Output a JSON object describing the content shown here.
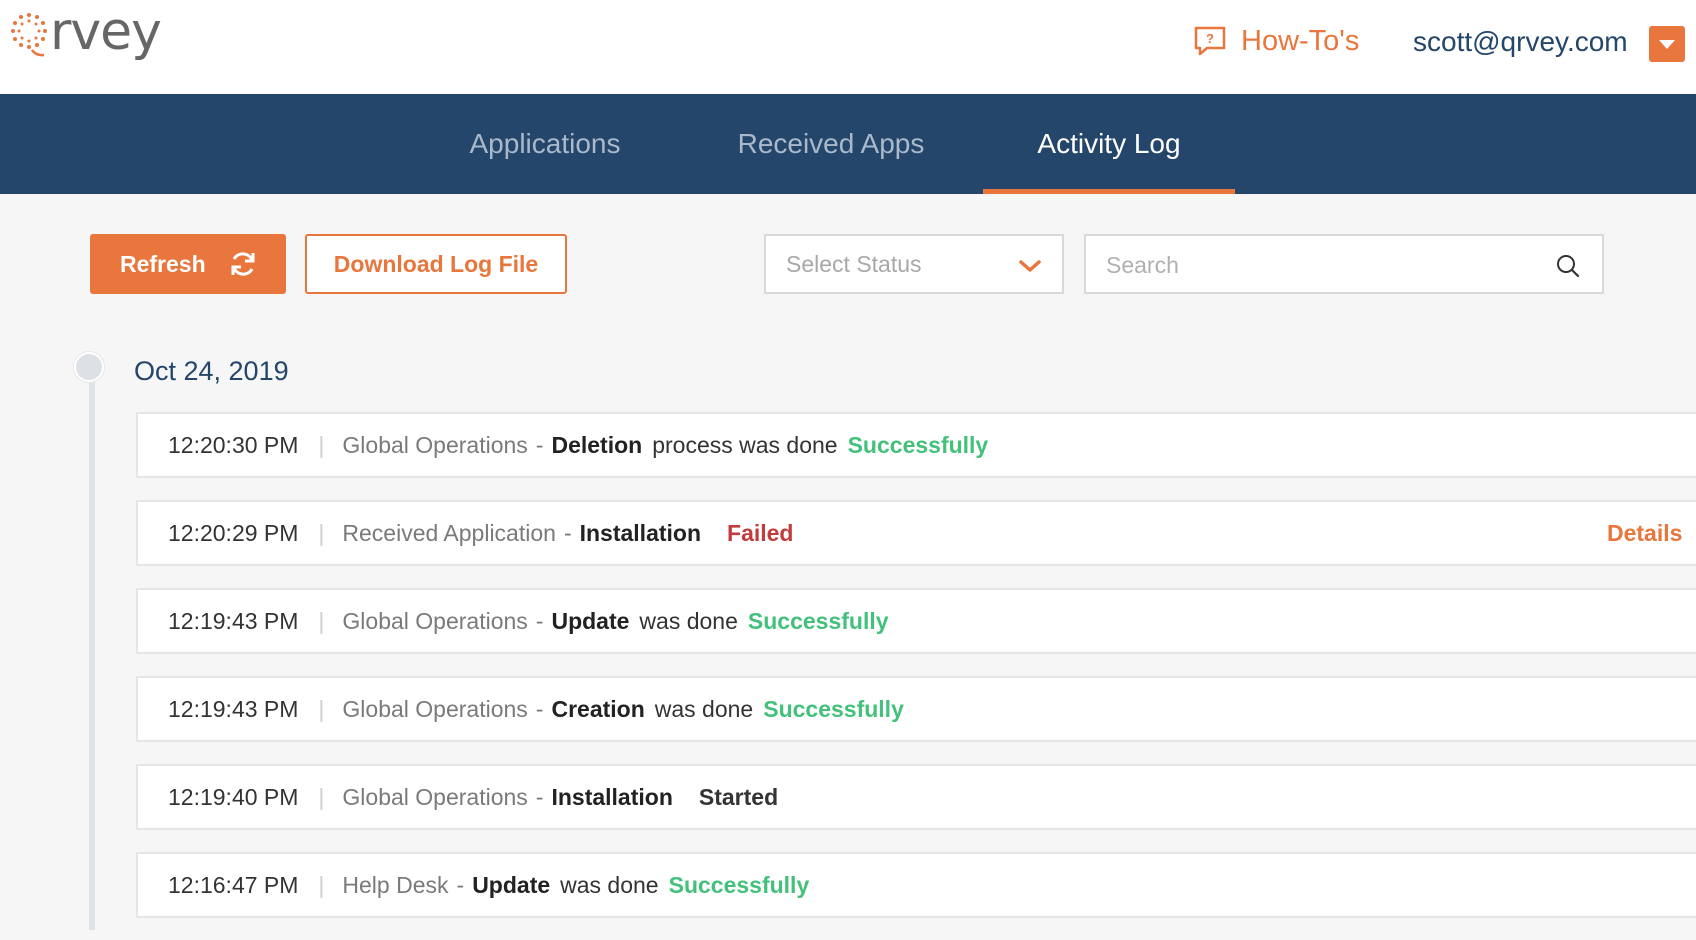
{
  "brand": {
    "logo_text": "rvey",
    "accent_color": "#e8763d",
    "nav_color": "#24466b"
  },
  "header": {
    "howto_label": "How-To's",
    "user_email": "scott@qrvey.com"
  },
  "nav": {
    "tabs": [
      {
        "label": "Applications",
        "active": false
      },
      {
        "label": "Received Apps",
        "active": false
      },
      {
        "label": "Activity Log",
        "active": true
      }
    ]
  },
  "toolbar": {
    "refresh_label": "Refresh",
    "download_label": "Download Log File",
    "status_placeholder": "Select Status",
    "search_placeholder": "Search"
  },
  "log": {
    "date": "Oct 24, 2019",
    "entries": [
      {
        "time": "12:20:30 PM",
        "source": "Global Operations",
        "action": "Deletion",
        "middle": "process was done",
        "status": "Successfully",
        "status_type": "success"
      },
      {
        "time": "12:20:29 PM",
        "source": "Received Application",
        "action": "Installation",
        "middle": "",
        "status": "Failed",
        "status_type": "failed",
        "details": "Details"
      },
      {
        "time": "12:19:43 PM",
        "source": "Global Operations",
        "action": "Update",
        "middle": "was done",
        "status": "Successfully",
        "status_type": "success"
      },
      {
        "time": "12:19:43 PM",
        "source": "Global Operations",
        "action": "Creation",
        "middle": "was done",
        "status": "Successfully",
        "status_type": "success"
      },
      {
        "time": "12:19:40 PM",
        "source": "Global Operations",
        "action": "Installation",
        "middle": "",
        "status": "Started",
        "status_type": "started"
      },
      {
        "time": "12:16:47 PM",
        "source": "Help Desk",
        "action": "Update",
        "middle": "was done",
        "status": "Successfully",
        "status_type": "success"
      }
    ]
  }
}
